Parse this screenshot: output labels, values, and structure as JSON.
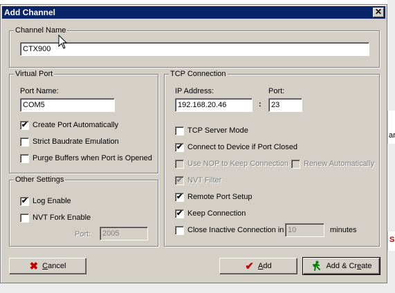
{
  "dialog": {
    "title": "Add Channel",
    "close_glyph": "✕"
  },
  "channel_name": {
    "group_label": "Channel Name",
    "value": "CTX900"
  },
  "virtual_port": {
    "group_label": "Virtual Port",
    "port_name_label": "Port Name:",
    "port_name_value": "COM5",
    "options": [
      {
        "label": "Create Port Automatically",
        "checked": true
      },
      {
        "label": "Strict Baudrate Emulation",
        "checked": false
      },
      {
        "label": "Purge Buffers when Port is Opened",
        "checked": false
      }
    ]
  },
  "other_settings": {
    "group_label": "Other Settings",
    "log_enable": {
      "label": "Log Enable",
      "checked": true
    },
    "nvt_fork": {
      "label": "NVT Fork Enable",
      "checked": false
    },
    "port_label": "Port:",
    "port_value": "2005"
  },
  "tcp": {
    "group_label": "TCP Connection",
    "ip_label": "IP Address:",
    "ip_value": "192.168.20.46",
    "colon": ":",
    "port_label": "Port:",
    "port_value": "23",
    "server_mode": {
      "label": "TCP Server Mode",
      "checked": false
    },
    "connect_if_closed": {
      "label": "Connect to Device if Port Closed",
      "checked": true
    },
    "use_nop": {
      "label": "Use NOP to Keep Connection",
      "checked": false,
      "disabled": true
    },
    "renew_auto": {
      "label": "Renew Automatically",
      "checked": false,
      "disabled": true
    },
    "nvt_filter": {
      "label": "NVT Filter",
      "checked": true,
      "disabled": true
    },
    "remote_port_setup": {
      "label": "Remote Port Setup",
      "checked": true
    },
    "keep_connection": {
      "label": "Keep Connection",
      "checked": true
    },
    "close_inactive": {
      "label": "Close Inactive Connection in",
      "checked": false,
      "value": "10",
      "unit": "minutes"
    }
  },
  "buttons": {
    "cancel_first": "C",
    "cancel_rest": "ancel",
    "add_first": "A",
    "add_rest": "dd",
    "add_create_pre": "Add & Cr",
    "add_create_u": "e",
    "add_create_post": "ate"
  },
  "checkmark": "✔",
  "icons": {
    "cancel": "x-icon",
    "add": "checkmark-icon",
    "add_create": "running-person-icon"
  },
  "colors": {
    "titlebar": "#0a246a",
    "dialog_bg": "#d4d0c8",
    "cancel_icon": "#c00000",
    "add_icon": "#d00000",
    "create_icon": "#008000"
  },
  "background_peek": [
    "ar",
    "S"
  ]
}
